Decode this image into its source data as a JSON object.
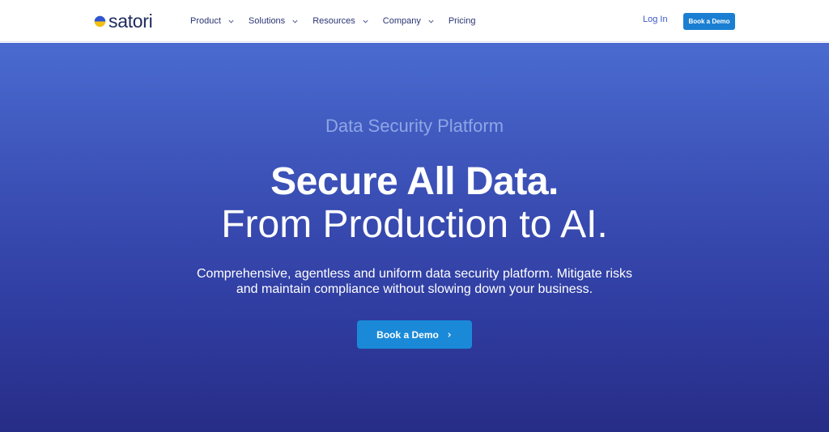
{
  "brand": {
    "name": "satori",
    "colors": {
      "navy": "#1d2a5c",
      "yellow": "#f2c012",
      "blue": "#2f55d4"
    }
  },
  "nav": {
    "items": [
      {
        "label": "Product",
        "has_dropdown": true
      },
      {
        "label": "Solutions",
        "has_dropdown": true
      },
      {
        "label": "Resources",
        "has_dropdown": true
      },
      {
        "label": "Company",
        "has_dropdown": true
      },
      {
        "label": "Pricing",
        "has_dropdown": false
      }
    ],
    "login_label": "Log In",
    "cta_label": "Book a Demo"
  },
  "hero": {
    "eyebrow": "Data Security Platform",
    "headline_bold": "Secure All Data.",
    "headline_light": "From Production to AI.",
    "subtext": "Comprehensive, agentless and uniform data security platform. Mitigate risks and maintain compliance without slowing down your business.",
    "cta_label": "Book a Demo",
    "cta_icon": "chevron-right-icon",
    "colors": {
      "gradient_top": "#4a6bd0",
      "gradient_bottom": "#272d86",
      "cta": "#1a8ad8"
    }
  }
}
